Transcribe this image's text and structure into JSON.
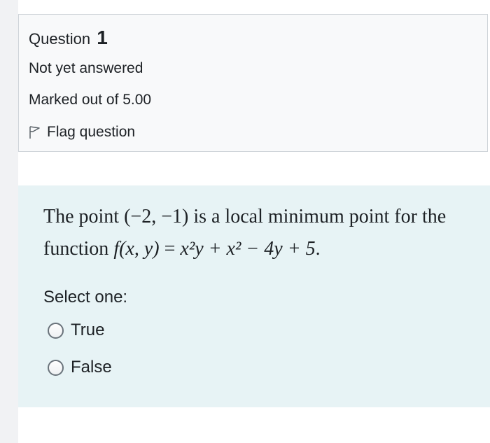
{
  "info": {
    "question_label": "Question",
    "question_number": "1",
    "state": "Not yet answered",
    "grade": "Marked out of 5.00",
    "flag_label": "Flag question",
    "flag_icon": "flag-outline-icon"
  },
  "question": {
    "text_part1": "The point ",
    "point": "(−2, −1)",
    "text_part2": " is a local minimum point for the function ",
    "function_lhs": "f(x, y)",
    "equals": " = ",
    "function_rhs": "x²y + x² − 4y + 5",
    "end": "."
  },
  "answer": {
    "prompt": "Select one:",
    "options": [
      {
        "label": "True",
        "selected": false
      },
      {
        "label": "False",
        "selected": false
      }
    ]
  },
  "colors": {
    "info_bg": "#f8f9fa",
    "info_border": "#cfd4d9",
    "formulation_bg": "#e7f3f5",
    "text": "#1d2125"
  }
}
